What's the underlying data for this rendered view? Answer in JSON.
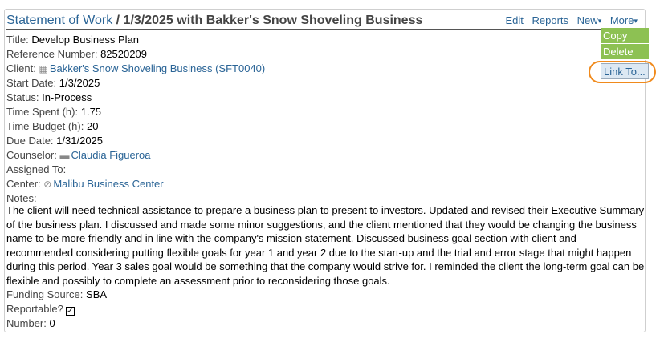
{
  "header": {
    "title_link": "Statement of Work",
    "title_rest": " / 1/3/2025 with Bakker's Snow Shoveling Business",
    "actions": {
      "edit": "Edit",
      "reports": "Reports",
      "new": "New",
      "more": "More",
      "caret": "▾"
    }
  },
  "more_menu": {
    "items": [
      "Copy",
      "Delete",
      "Link To..."
    ]
  },
  "fields": {
    "title_label": "Title:",
    "title_value": "Develop Business Plan",
    "ref_label": "Reference Number:",
    "ref_value": "82520209",
    "client_label": "Client:",
    "client_value": "Bakker's Snow Shoveling Business (SFT0040)",
    "start_label": "Start Date:",
    "start_value": "1/3/2025",
    "status_label": "Status:",
    "status_value": "In-Process",
    "spent_label": "Time Spent (h):",
    "spent_value": "1.75",
    "budget_label": "Time Budget (h):",
    "budget_value": "20",
    "due_label": "Due Date:",
    "due_value": "1/31/2025",
    "counselor_label": "Counselor:",
    "counselor_value": "Claudia Figueroa",
    "assigned_label": "Assigned To:",
    "center_label": "Center:",
    "center_value": "Malibu Business Center",
    "notes_label": "Notes:"
  },
  "notes_text": "The client will need technical assistance to prepare a business plan to present to investors. Updated and revised their Executive Summary of the business plan. I discussed and made some minor suggestions, and the client mentioned that they would be changing the business name to be more friendly and in line with the company's mission statement. Discussed business goal section with client and recommended considering putting flexible goals for year 1 and year 2 due to the start-up and the trial and error stage that might happen during this period. Year 3 sales goal would be something that the company would strive for. I reminded the client the long-term goal can be flexible and possibly to complete an assessment prior to reconsidering those goals.",
  "bottom": {
    "funding_label": "Funding Source:",
    "funding_value": "SBA",
    "reportable_label": "Reportable?",
    "reportable_checked": true,
    "check_mark": "✓",
    "number_label": "Number:",
    "number_value": "0"
  },
  "icons": {
    "client": "building-icon",
    "counselor": "briefcase-icon",
    "center": "compass-icon"
  },
  "colors": {
    "link": "#2a6496",
    "menu_green": "#8dc153",
    "highlight_ring": "#f08a1c"
  }
}
